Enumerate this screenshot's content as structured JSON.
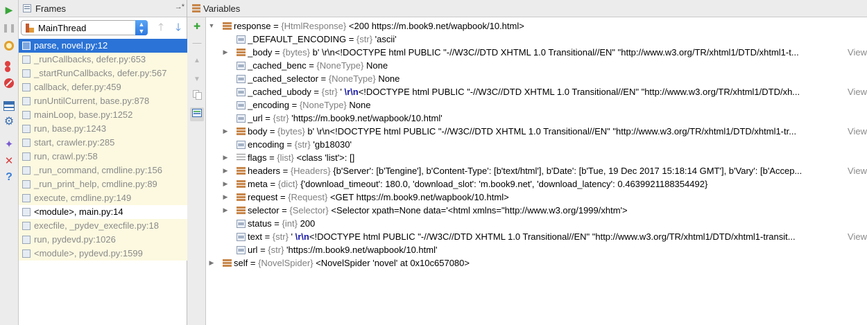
{
  "frames_panel": {
    "title": "Frames",
    "pin": "→*",
    "thread": "MainThread",
    "frames": [
      {
        "label": "parse, novel.py:12",
        "state": "selected"
      },
      {
        "label": "_runCallbacks, defer.py:653",
        "state": "library"
      },
      {
        "label": "_startRunCallbacks, defer.py:567",
        "state": "library"
      },
      {
        "label": "callback, defer.py:459",
        "state": "library"
      },
      {
        "label": "runUntilCurrent, base.py:878",
        "state": "library"
      },
      {
        "label": "mainLoop, base.py:1252",
        "state": "library"
      },
      {
        "label": "run, base.py:1243",
        "state": "library"
      },
      {
        "label": "start, crawler.py:285",
        "state": "library"
      },
      {
        "label": "run, crawl.py:58",
        "state": "library"
      },
      {
        "label": "_run_command, cmdline.py:156",
        "state": "library"
      },
      {
        "label": "_run_print_help, cmdline.py:89",
        "state": "library"
      },
      {
        "label": "execute, cmdline.py:149",
        "state": "library"
      },
      {
        "label": "<module>, main.py:14",
        "state": "active"
      },
      {
        "label": "execfile, _pydev_execfile.py:18",
        "state": "library"
      },
      {
        "label": "run, pydevd.py:1026",
        "state": "library"
      },
      {
        "label": "<module>, pydevd.py:1599",
        "state": "library"
      }
    ]
  },
  "variables_panel": {
    "title": "Variables",
    "view_label": "View",
    "rows": [
      {
        "depth": 0,
        "arrow": "down",
        "icon": "bars",
        "name": "response",
        "type": "{HtmlResponse}",
        "value": "<200 https://m.book9.net/wapbook/10.html>",
        "view": false
      },
      {
        "depth": 1,
        "arrow": "none",
        "icon": "prim",
        "name": "_DEFAULT_ENCODING",
        "type": "{str}",
        "value": "'ascii'",
        "view": false
      },
      {
        "depth": 1,
        "arrow": "right",
        "icon": "bars",
        "name": "_body",
        "type": "{bytes}",
        "value": "b'  \\r\\n<!DOCTYPE html PUBLIC \"-//W3C//DTD XHTML 1.0 Transitional//EN\" \"http://www.w3.org/TR/xhtml1/DTD/xhtml1-t...",
        "view": true
      },
      {
        "depth": 1,
        "arrow": "none",
        "icon": "prim",
        "name": "_cached_benc",
        "type": "{NoneType}",
        "value": "None",
        "view": false
      },
      {
        "depth": 1,
        "arrow": "none",
        "icon": "prim",
        "name": "_cached_selector",
        "type": "{NoneType}",
        "value": "None",
        "view": false
      },
      {
        "depth": 1,
        "arrow": "none",
        "icon": "prim",
        "name": "_cached_ubody",
        "type": "{str}",
        "value": "'  \\r\\n<!DOCTYPE html PUBLIC \"-//W3C//DTD XHTML 1.0 Transitional//EN\" \"http://www.w3.org/TR/xhtml1/DTD/xh...",
        "view": true,
        "esc": true
      },
      {
        "depth": 1,
        "arrow": "none",
        "icon": "prim",
        "name": "_encoding",
        "type": "{NoneType}",
        "value": "None",
        "view": false
      },
      {
        "depth": 1,
        "arrow": "none",
        "icon": "prim",
        "name": "_url",
        "type": "{str}",
        "value": "'https://m.book9.net/wapbook/10.html'",
        "view": false
      },
      {
        "depth": 1,
        "arrow": "right",
        "icon": "bars",
        "name": "body",
        "type": "{bytes}",
        "value": "b'  \\r\\n<!DOCTYPE html PUBLIC \"-//W3C//DTD XHTML 1.0 Transitional//EN\" \"http://www.w3.org/TR/xhtml1/DTD/xhtml1-tr...",
        "view": true
      },
      {
        "depth": 1,
        "arrow": "none",
        "icon": "prim",
        "name": "encoding",
        "type": "{str}",
        "value": "'gb18030'",
        "view": false
      },
      {
        "depth": 1,
        "arrow": "right",
        "icon": "list",
        "name": "flags",
        "type": "{list}",
        "value": "<class 'list'>: []",
        "view": false
      },
      {
        "depth": 1,
        "arrow": "right",
        "icon": "bars",
        "name": "headers",
        "type": "{Headers}",
        "value": "{b'Server': [b'Tengine'], b'Content-Type': [b'text/html'], b'Date': [b'Tue, 19 Dec 2017 15:18:14 GMT'], b'Vary': [b'Accep...",
        "view": true
      },
      {
        "depth": 1,
        "arrow": "right",
        "icon": "bars",
        "name": "meta",
        "type": "{dict}",
        "value": "{'download_timeout': 180.0, 'download_slot': 'm.book9.net', 'download_latency': 0.4639921188354492}",
        "view": false
      },
      {
        "depth": 1,
        "arrow": "right",
        "icon": "bars",
        "name": "request",
        "type": "{Request}",
        "value": "<GET https://m.book9.net/wapbook/10.html>",
        "view": false
      },
      {
        "depth": 1,
        "arrow": "right",
        "icon": "bars",
        "name": "selector",
        "type": "{Selector}",
        "value": "<Selector xpath=None data='<html xmlns=\"http://www.w3.org/1999/xhtm'>",
        "view": false
      },
      {
        "depth": 1,
        "arrow": "none",
        "icon": "prim",
        "name": "status",
        "type": "{int}",
        "value": "200",
        "view": false
      },
      {
        "depth": 1,
        "arrow": "none",
        "icon": "prim",
        "name": "text",
        "type": "{str}",
        "value": "'  \\r\\n<!DOCTYPE html PUBLIC \"-//W3C//DTD XHTML 1.0 Transitional//EN\" \"http://www.w3.org/TR/xhtml1/DTD/xhtml1-transit...",
        "view": true,
        "esc": true
      },
      {
        "depth": 1,
        "arrow": "none",
        "icon": "prim",
        "name": "url",
        "type": "{str}",
        "value": "'https://m.book9.net/wapbook/10.html'",
        "view": false
      },
      {
        "depth": 0,
        "arrow": "right",
        "icon": "bars",
        "name": "self",
        "type": "{NovelSpider}",
        "value": "<NovelSpider 'novel' at 0x10c657080>",
        "view": false
      }
    ]
  },
  "toolbar_icons": [
    "resume-icon",
    "pause-icon",
    "mute-breakpoints-icon",
    "view-breakpoints-icon",
    "stop-icon",
    "layout-icon",
    "settings-icon",
    "pin-icon",
    "close-icon",
    "help-icon"
  ],
  "colors": {
    "selection": "#2b73d6",
    "library_frame_bg": "#fcf9e0",
    "escape_text": "#1a1aa6",
    "type_text": "#808080"
  }
}
